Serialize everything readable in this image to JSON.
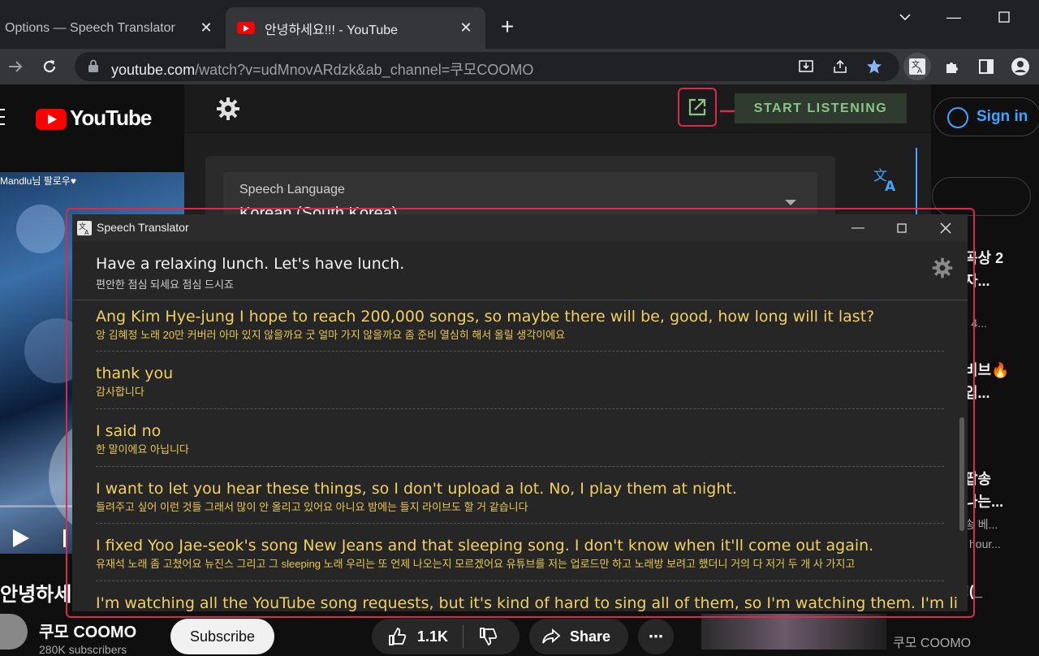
{
  "browser": {
    "tabs": [
      {
        "label": "Options — Speech Translator",
        "active": false
      },
      {
        "label": "안녕하세요!!! - YouTube",
        "active": true
      }
    ],
    "url_host": "youtube.com",
    "url_path": "/watch?v=udMnovARdzk&ab_channel=쿠모COOMO"
  },
  "youtube": {
    "logo": "YouTube",
    "video_banner": "Mandlu님 팔로우♥",
    "video_title": "안녕하세",
    "channel_name": "쿠모 COOMO",
    "subscribers": "280K subscribers",
    "subscribe_label": "Subscribe",
    "likes": "1.1K",
    "share_label": "Share",
    "signin_label": "Sign in",
    "sidebar": {
      "line1": "곡상 2",
      "line2": "자...",
      "line3": "· 4...",
      "line4": "비브🔥",
      "line5": "입...",
      "line6": "팝송",
      "line7": "나는...",
      "line8": "송 베...",
      "line9": "hour...",
      "line10": "!(_",
      "line11": "쿠모 COOMO"
    }
  },
  "extension": {
    "start_label": "START LISTENING",
    "speech_language_label": "Speech Language",
    "speech_language_value": "Korean (South Korea)"
  },
  "translator_window": {
    "title": "Speech Translator",
    "current": {
      "en": "Have a relaxing lunch. Let's have lunch.",
      "ko": "편안한 점심 되세요 점심 드시죠"
    },
    "entries": [
      {
        "en": "Ang Kim Hye-jung I hope to reach 200,000 songs, so maybe there will be, good, how long will it last?",
        "ko": "앙 김혜정 노래 20만 커버러 아마 있지 않을까요 굿 얼마 가지 않을까요 좀 준비 열심히 해서 올릴 생각이에요"
      },
      {
        "en": "thank you",
        "ko": "감사합니다"
      },
      {
        "en": "I said no",
        "ko": "한 말이에요 아닙니다"
      },
      {
        "en": "I want to let you hear these things, so I don't upload a lot. No, I play them at night.",
        "ko": "들려주고 싶어 이런 것들 그래서 많이 안 올리고 있어요 아니요 밤에는 들지 라이브도 할 거 같습니다"
      },
      {
        "en": "I fixed Yoo Jae-seok's song New Jeans and that sleeping song. I don't know when it'll come out again.",
        "ko": "유재석 노래 좀 고쳤어요 뉴진스 그리고 그 sleeping 노래 우리는 또 언제 나오는지 모르겠어요 유튜브를 저는 업로드만 하고 노래방 보려고 했더니 거의 다 저거 두 개 사 가지고"
      },
      {
        "en": "I'm watching all the YouTube song requests, but it's kind of hard to sing all of them, so I'm watching them. I'm listening",
        "ko": ""
      }
    ]
  },
  "colors": {
    "highlight_frame": "#d62d4c",
    "translation_text": "#f0d060",
    "start_button_text": "#8bc48a",
    "youtube_red": "#ff0000",
    "link_blue": "#3ea6ff"
  }
}
